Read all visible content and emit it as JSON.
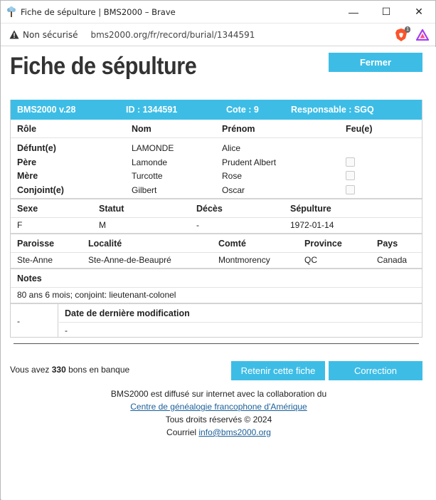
{
  "window": {
    "title": "Fiche de sépulture | BMS2000 – Brave",
    "minimize_glyph": "—",
    "maximize_glyph": "☐",
    "close_glyph": "✕"
  },
  "addressbar": {
    "security_text": "Non sécurisé",
    "url": "bms2000.org/fr/record/burial/1344591",
    "brave_badge": "1"
  },
  "page": {
    "title": "Fiche de sépulture",
    "close_label": "Fermer"
  },
  "record": {
    "header": {
      "version": "BMS2000 v.28",
      "id": "ID : 1344591",
      "cote": "Cote : 9",
      "responsable": "Responsable : SGQ"
    },
    "people_headers": [
      "Rôle",
      "Nom",
      "Prénom",
      "Feu(e)"
    ],
    "people": [
      {
        "role": "Défunt(e)",
        "nom": "LAMONDE",
        "prenom": "Alice",
        "checkbox": false
      },
      {
        "role": "Père",
        "nom": "Lamonde",
        "prenom": "Prudent Albert",
        "checkbox": true
      },
      {
        "role": "Mère",
        "nom": "Turcotte",
        "prenom": "Rose",
        "checkbox": true
      },
      {
        "role": "Conjoint(e)",
        "nom": "Gilbert",
        "prenom": "Oscar",
        "checkbox": true
      }
    ],
    "event_headers": [
      "Sexe",
      "Statut",
      "Décès",
      "Sépulture"
    ],
    "event_values": [
      "F",
      "M",
      "-",
      "1972-01-14"
    ],
    "place_headers": [
      "Paroisse",
      "Localité",
      "Comté",
      "Province",
      "Pays"
    ],
    "place_values": [
      "Ste-Anne",
      "Ste-Anne-de-Beaupré",
      "Montmorency",
      "QC",
      "Canada"
    ],
    "notes_header": "Notes",
    "notes_value": "80 ans 6 mois; conjoint: lieutenant-colonel",
    "modif_left": "-",
    "modif_header": "Date de dernière modification",
    "modif_value": "-"
  },
  "bank": {
    "prefix": "Vous avez ",
    "count": "330",
    "suffix": " bons en banque"
  },
  "buttons": {
    "retain": "Retenir cette fiche",
    "correction": "Correction"
  },
  "footer": {
    "line1": "BMS2000 est diffusé sur internet avec la collaboration du",
    "link1": "Centre de généalogie francophone d'Amérique",
    "line3": "Tous droits réservés © 2024",
    "line4_prefix": "Courriel ",
    "email": "info@bms2000.org"
  },
  "colors": {
    "accent": "#3dbde6",
    "link": "#1a5f99"
  }
}
